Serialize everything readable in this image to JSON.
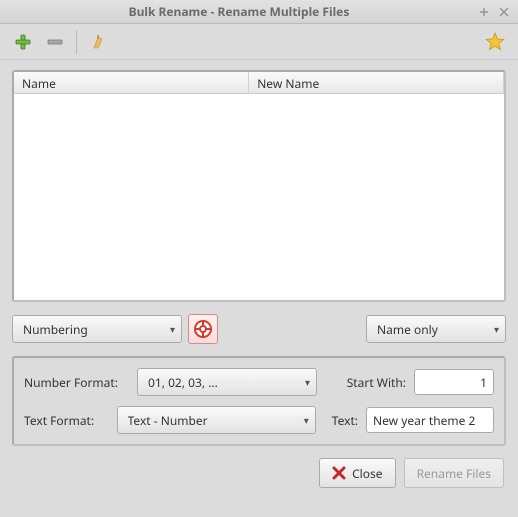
{
  "title": "Bulk Rename - Rename Multiple Files",
  "icons": {
    "add": "add-icon",
    "remove": "remove-icon",
    "clear": "clear-icon",
    "favorite": "star-icon",
    "help": "help-icon",
    "close": "close-x-icon"
  },
  "columns": {
    "name": "Name",
    "newname": "New Name"
  },
  "modeRow": {
    "mode": "Numbering",
    "scope": "Name only"
  },
  "options": {
    "numberFormatLabel": "Number Format:",
    "numberFormat": "01, 02, 03, ...",
    "startWithLabel": "Start With:",
    "startWith": "1",
    "textFormatLabel": "Text Format:",
    "textFormat": "Text - Number",
    "textLabel": "Text:",
    "text": "New year theme 2"
  },
  "footer": {
    "close": "Close",
    "rename": "Rename Files"
  }
}
